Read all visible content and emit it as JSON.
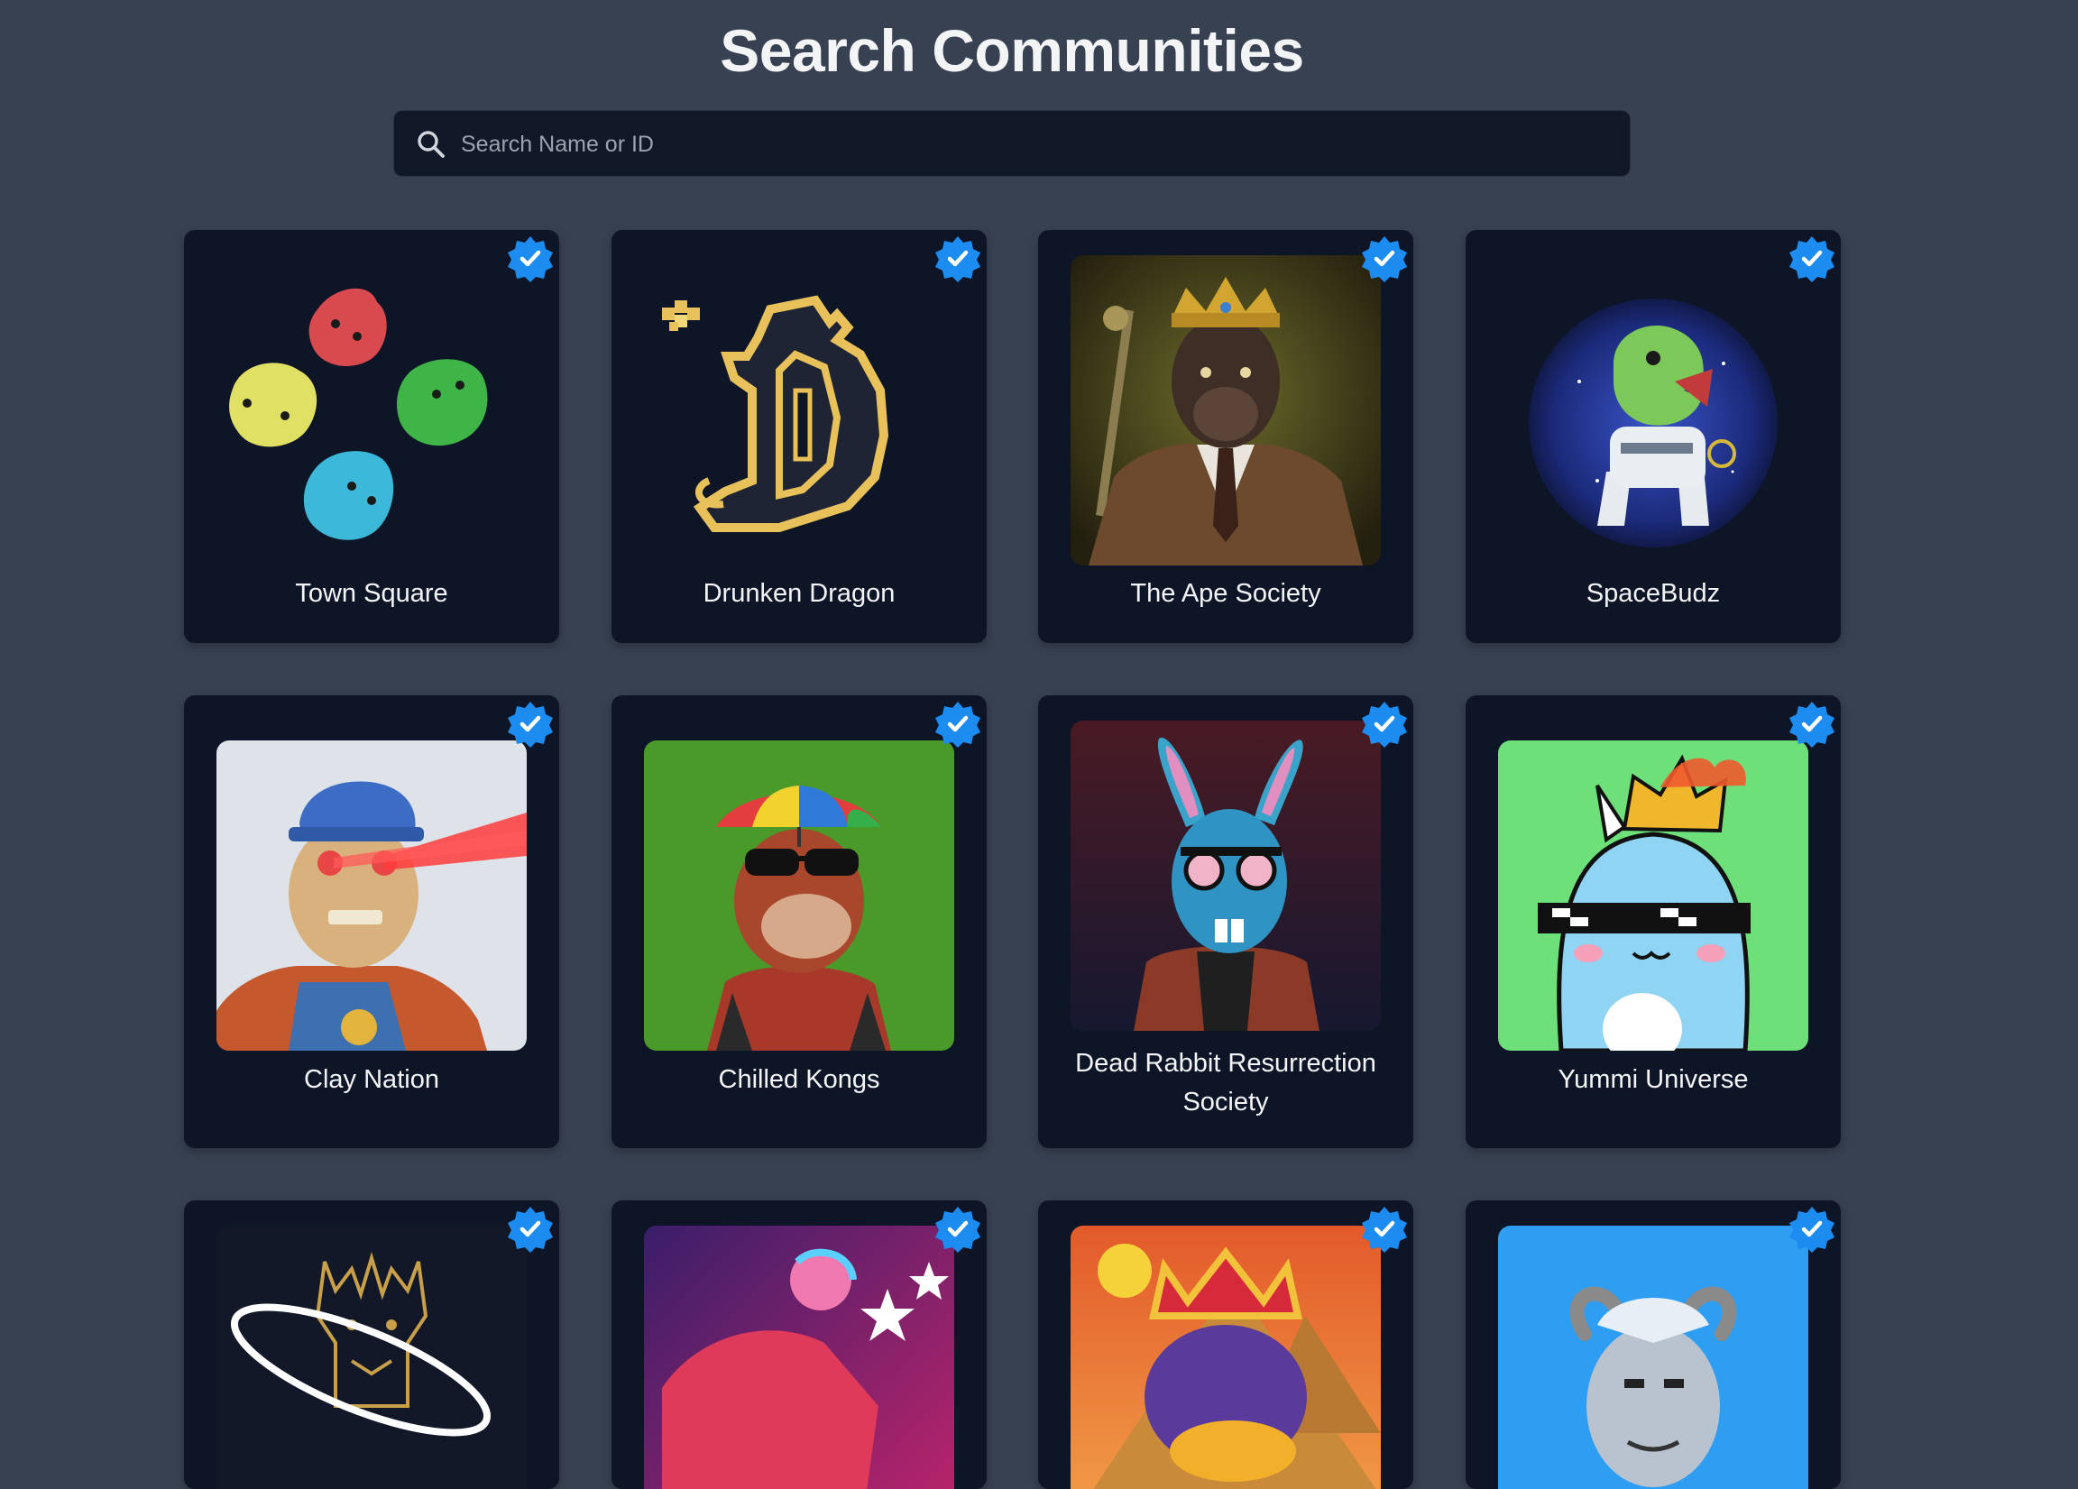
{
  "page": {
    "title": "Search Communities"
  },
  "search": {
    "placeholder": "Search Name or ID",
    "value": ""
  },
  "communities": [
    {
      "name": "Town Square",
      "verified": true
    },
    {
      "name": "Drunken Dragon",
      "verified": true
    },
    {
      "name": "The Ape Society",
      "verified": true
    },
    {
      "name": "SpaceBudz",
      "verified": true
    },
    {
      "name": "Clay Nation",
      "verified": true
    },
    {
      "name": "Chilled Kongs",
      "verified": true
    },
    {
      "name": "Dead Rabbit Resurrection Society",
      "verified": true
    },
    {
      "name": "Yummi Universe",
      "verified": true
    },
    {
      "name": "",
      "verified": true
    },
    {
      "name": "",
      "verified": true
    },
    {
      "name": "",
      "verified": true
    },
    {
      "name": "",
      "verified": true
    }
  ],
  "colors": {
    "background": "#374151",
    "card": "#0e1527",
    "verified_badge": "#1d8cf0",
    "search_bg": "#111827"
  }
}
